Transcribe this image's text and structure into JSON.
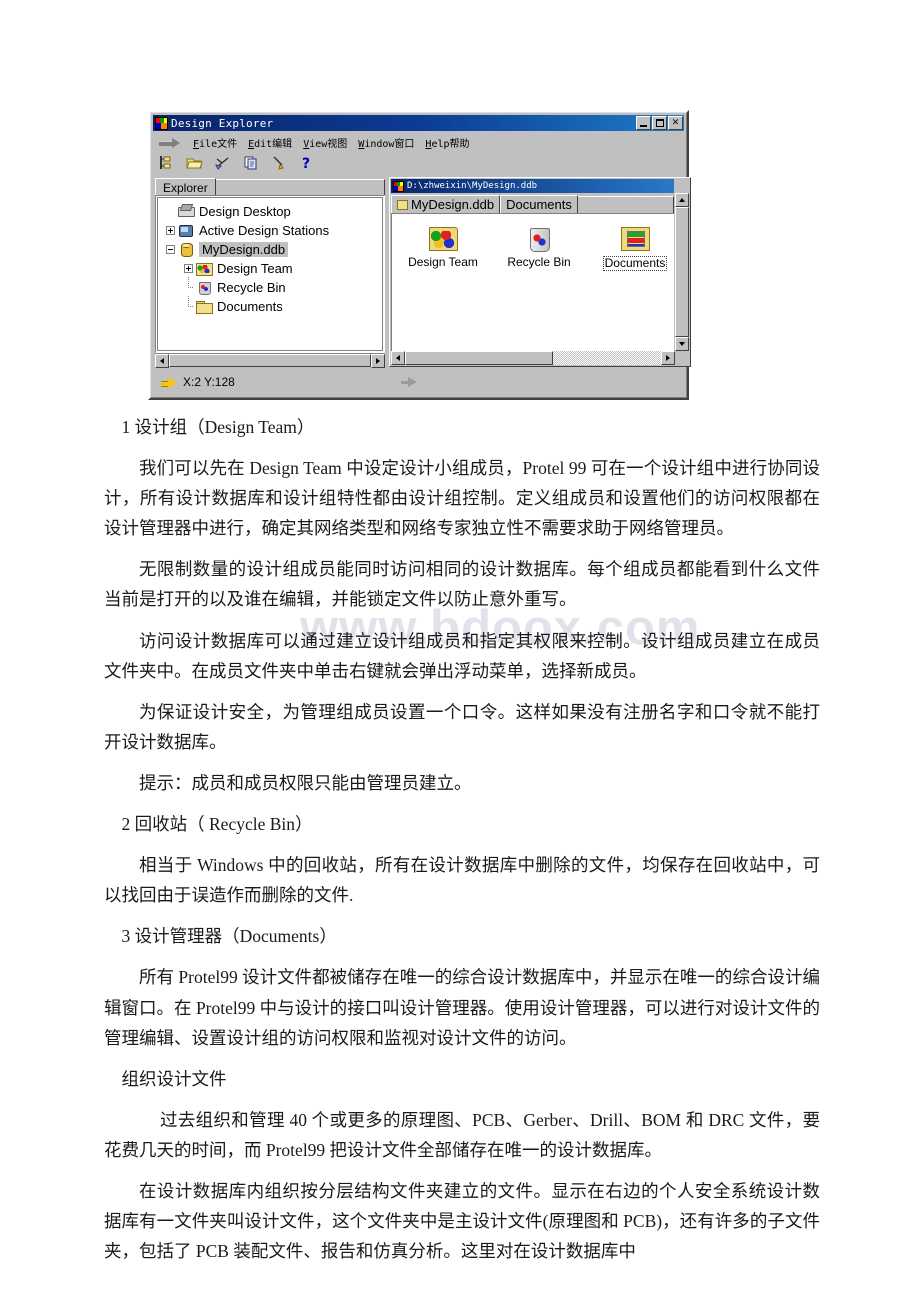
{
  "watermark": "www.bdoox.com",
  "screenshot": {
    "window_title": "Design Explorer",
    "titlebar_icon": "protel-app-icon",
    "window_buttons": [
      {
        "name": "minimize-button",
        "glyph": "_"
      },
      {
        "name": "maximize-button",
        "glyph": "□"
      },
      {
        "name": "close-button",
        "glyph": "X"
      }
    ],
    "menus": [
      {
        "mnemonic": "F",
        "rest": "ile文件"
      },
      {
        "mnemonic": "E",
        "rest": "dit编辑"
      },
      {
        "mnemonic": "V",
        "rest": "iew视图"
      },
      {
        "mnemonic": "W",
        "rest": "indow窗口"
      },
      {
        "mnemonic": "H",
        "rest": "elp帮助"
      }
    ],
    "toolbar": [
      {
        "name": "design-manager-icon",
        "title": "Design Manager"
      },
      {
        "name": "open-folder-icon",
        "title": "Open"
      },
      {
        "name": "cut-scissors-icon",
        "title": "Cut"
      },
      {
        "name": "copy-icon",
        "title": "Copy"
      },
      {
        "name": "paste-icon",
        "title": "Paste"
      },
      {
        "name": "help-question-icon",
        "title": "Help"
      }
    ],
    "explorer_tab": "Explorer",
    "tree": [
      {
        "label": "Design Desktop",
        "icon": "desktop-icon",
        "expander": "none",
        "indent": 0,
        "selected": false
      },
      {
        "label": "Active Design Stations",
        "icon": "station-icon",
        "expander": "plus",
        "indent": 0,
        "selected": false
      },
      {
        "label": "MyDesign.ddb",
        "icon": "ddb-icon",
        "expander": "minus",
        "indent": 0,
        "selected": true
      },
      {
        "label": "Design Team",
        "icon": "team-icon",
        "expander": "plus",
        "indent": 1,
        "selected": false
      },
      {
        "label": "Recycle Bin",
        "icon": "recycle-bin-icon",
        "expander": "stub",
        "indent": 1,
        "selected": false
      },
      {
        "label": "Documents",
        "icon": "folder-icon",
        "expander": "stub",
        "indent": 1,
        "selected": false
      }
    ],
    "mdi": {
      "title": "D:\\zhweixin\\MyDesign.ddb",
      "tabs": [
        {
          "label": "MyDesign.ddb",
          "active": true,
          "has_icon": true
        },
        {
          "label": "Documents",
          "active": false,
          "has_icon": false
        }
      ],
      "items": [
        {
          "label": "Design Team",
          "icon": "design-team-folder-icon",
          "focused": false
        },
        {
          "label": "Recycle Bin",
          "icon": "recycle-bin-icon",
          "focused": false
        },
        {
          "label": "Documents",
          "icon": "documents-folder-icon",
          "focused": true
        }
      ]
    },
    "statusbar": {
      "coords": "X:2 Y:128",
      "left_icon": "yellow-arrow-icon",
      "right_icon": "gray-arrow-icon"
    }
  },
  "document": {
    "paragraphs": [
      {
        "style": "head",
        "text": "1 设计组（Design Team）"
      },
      {
        "style": "indent",
        "text": "我们可以先在 Design Team 中设定设计小组成员，Protel 99 可在一个设计组中进行协同设计，所有设计数据库和设计组特性都由设计组控制。定义组成员和设置他们的访问权限都在设计管理器中进行，确定其网络类型和网络专家独立性不需要求助于网络管理员。"
      },
      {
        "style": "indent",
        "text": "无限制数量的设计组成员能同时访问相同的设计数据库。每个组成员都能看到什么文件当前是打开的以及谁在编辑，并能锁定文件以防止意外重写。"
      },
      {
        "style": "indent",
        "text": "访问设计数据库可以通过建立设计组成员和指定其权限来控制。设计组成员建立在成员文件夹中。在成员文件夹中单击右键就会弹出浮动菜单，选择新成员。"
      },
      {
        "style": "indent",
        "text": "为保证设计安全，为管理组成员设置一个口令。这样如果没有注册名字和口令就不能打开设计数据库。"
      },
      {
        "style": "indent",
        "text": "提示：成员和成员权限只能由管理员建立。"
      },
      {
        "style": "head",
        "text": "2 回收站（ Recycle Bin）"
      },
      {
        "style": "indent",
        "text": "相当于 Windows 中的回收站，所有在设计数据库中删除的文件，均保存在回收站中，可以找回由于误造作而删除的文件."
      },
      {
        "style": "head",
        "text": "3 设计管理器（Documents）"
      },
      {
        "style": "indent",
        "text": "所有 Protel99 设计文件都被储存在唯一的综合设计数据库中，并显示在唯一的综合设计编辑窗口。在 Protel99 中与设计的接口叫设计管理器。使用设计管理器，可以进行对设计文件的管理编辑、设置设计组的访问权限和监视对设计文件的访问。"
      },
      {
        "style": "head",
        "text": "组织设计文件"
      },
      {
        "style": "wide",
        "text": "过去组织和管理 40 个或更多的原理图、PCB、Gerber、Drill、BOM 和 DRC 文件，要花费几天的时间，而 Protel99 把设计文件全部储存在唯一的设计数据库。"
      },
      {
        "style": "indent",
        "text": "在设计数据库内组织按分层结构文件夹建立的文件。显示在右边的个人安全系统设计数据库有一文件夹叫设计文件，这个文件夹中是主设计文件(原理图和 PCB)，还有许多的子文件夹，包括了 PCB 装配文件、报告和仿真分析。这里对在设计数据库中"
      }
    ]
  }
}
